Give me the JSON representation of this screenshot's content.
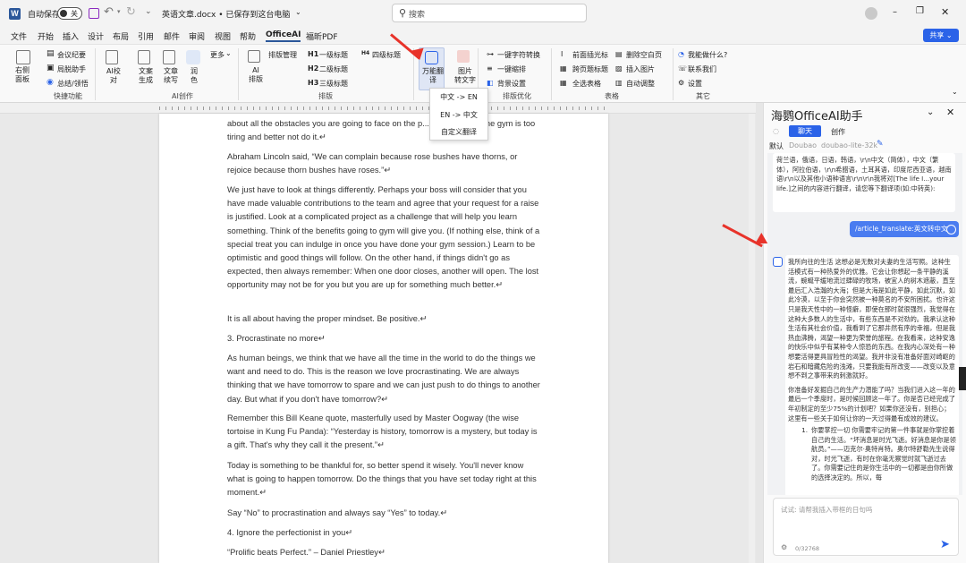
{
  "titlebar": {
    "autosave_label": "自动保存",
    "toggle_label": "关",
    "doc_title": "英语文章.docx • 已保存到这台电脑",
    "search_placeholder": "搜索"
  },
  "menu": [
    "文件",
    "开始",
    "插入",
    "设计",
    "布局",
    "引用",
    "邮件",
    "审阅",
    "视图",
    "帮助",
    "OfficeAI",
    "福昕PDF"
  ],
  "menu_active": "OfficeAI",
  "share_label": "共享",
  "ribbon": {
    "right_panel": "右侧\n面板",
    "meeting_minutes": "会议纪要",
    "bureau_assistant": "局脱助手",
    "summary": "总结/领悟",
    "ai_proofread": "AI校\n对",
    "text_gen": "文案\n生成",
    "text_continue": "文章\n续写",
    "polish": "润\n色",
    "more": "更多",
    "ai_format": "AI\n排版",
    "format_manage": "排版管理",
    "h1": "一级标题",
    "h2": "二级标题",
    "h3": "三级标题",
    "h4": "四级标题",
    "translate": "万能翻\n译",
    "img_to_text": "图片\n转文字",
    "one_key_convert": "一键字符转换",
    "one_key_indent": "一键缩排",
    "background": "背景设置",
    "delete_blank_rows": "前面插光标",
    "cross_page": "跨页题标题",
    "select_table": "全选表格",
    "delete_space": "删除空白页",
    "insert_image": "插入图片",
    "auto_adjust": "自动调整",
    "what_can_i_do": "我能做什么?",
    "contact_us": "联系我们",
    "settings": "设置",
    "groups": {
      "quick": "快捷功能",
      "ai_create": "AI创作",
      "format": "排版",
      "format_opt": "排版优化",
      "table": "表格",
      "other": "其它"
    }
  },
  "translate_menu": [
    "中文 -> EN",
    "EN -> 中文",
    "自定义翻译"
  ],
  "document": {
    "paragraphs": [
      "about all the obstacles you are going to face on the p... think going to the gym is too tiring and better not do it.↵",
      "Abraham Lincoln said, “We can complain because rose bushes have thorns, or rejoice because thorn bushes have roses.”↵",
      "We just have to look at things differently. Perhaps your boss will consider that you have made valuable contributions to the team and agree that your request for a raise is justified. Look at a complicated project as a challenge that will help you learn something. Think of the benefits going to gym will give you. (If nothing else, think of a special treat you can indulge in once you have done your gym session.) Learn to be optimistic and good things will follow. On the other hand, if things didn't go as expected, then always remember: When one door closes, another will open. The lost opportunity may not be for you but you are up for something much better.↵",
      "It is all about having the proper mindset. Be positive.↵",
      "3. Procrastinate no more↵",
      "As human beings, we think that we have all the time in the world to do the things we want and need to do. This is the reason we love procrastinating. We are always thinking that we have tomorrow to spare and we can just push to do things to another day. But what if you don't have tomorrow?↵",
      "Remember this Bill Keane quote, masterfully used by Master Oogway (the wise tortoise in Kung Fu Panda): “Yesterday is history, tomorrow is a mystery, but today is a gift. That's why they call it the present.”↵",
      "Today is something to be thankful for, so better spend it wisely. You'll never know what is going to happen tomorrow. Do the things that you have set today right at this moment.↵",
      "Say “No” to procrastination and always say “Yes” to today.↵",
      "4. Ignore the perfectionist in you↵",
      "“Prolific beats Perfect.” – Daniel Priestley↵"
    ]
  },
  "panel": {
    "title": "海鹦OfficeAI助手",
    "tab_chat": "聊天",
    "tab_create": "创作",
    "default_label": "默认",
    "model_provider": "Doubao",
    "model_name": "doubao-lite-32k",
    "prompt_text": "荷兰语，俄语，日语，韩语，\\r\\n中文（简体），中文（繁体），阿拉伯语，\\r\\n希腊语，土耳其语，印度尼西亚语，越南语\\r\\n以及其他小语种语言\\r\\n\\r\\n我将对[The life I...your life.]之间的内容进行翻译，请您等下翻译项(如:中转英):",
    "command_bubble": "/article_translate:英文转中文",
    "reply_p1": "我所向往的生活 这想必是无数对夫妻的生活写照。这种生活模式有一种热爱外的优雅。它会让你想起一条平静的溪流，蜿蜒平缓地流过肆碌的牧场，被宜人的树木遮蔽，直至最后汇入浩瀚的大海；但是大海是如此平静，如此沉默，如此冷漠，以至于你会突然被一种莫名的不安所困扰。也许这只是我天性中的一种怪癖，即使在那时就很强烈，我觉得在这种大多数人的生活中，有些东西是不对劲的。我承认这种生活有其社会价值，我看到了它那井然有序的幸福，但是我热血沸腾，渴望一种更为荣誉的旅程。在我看来，这种安逸的快乐中似乎有某种令人惊恐的东西。在我内心深处有一种想要活得更具冒险性的渴望。我并非没有准备好面对崎岖的岩石和暗藏危险的浅滩，只要我能有所改变——改变以及意想不到之事带来的刺激就好。",
    "reply_p2": "你准备好发掘自己的生产力潜能了吗？当我们进入这一年的最后一个季度时，是时候回顾这一年了。你是否已经完成了年初制定的至少75%的计划吧？如果你还没有，别担心；这里有一些关于如何让你的一天过得最有成效的建议。",
    "reply_list_1": "你要掌控一切 你需要牢记的第一件事就是你掌控着自己的生活。“坏消息是时光飞逝。好消息是你是领航员。”——迈克尔·奥特肖特。奥尔特舒勒先生说得对，时光飞逝，有时在你毫无察觉时就飞逝过去了。你需要记住的是你生活中的一切都是由你所做的选择决定的。所以，每",
    "input_placeholder": "试试: 请帮我插入带框的日句吗",
    "char_count": "0/32768",
    "colors": {
      "accent": "#2b63e8",
      "doc_blue": "#2b579a",
      "arrow": "#e8332a"
    }
  }
}
